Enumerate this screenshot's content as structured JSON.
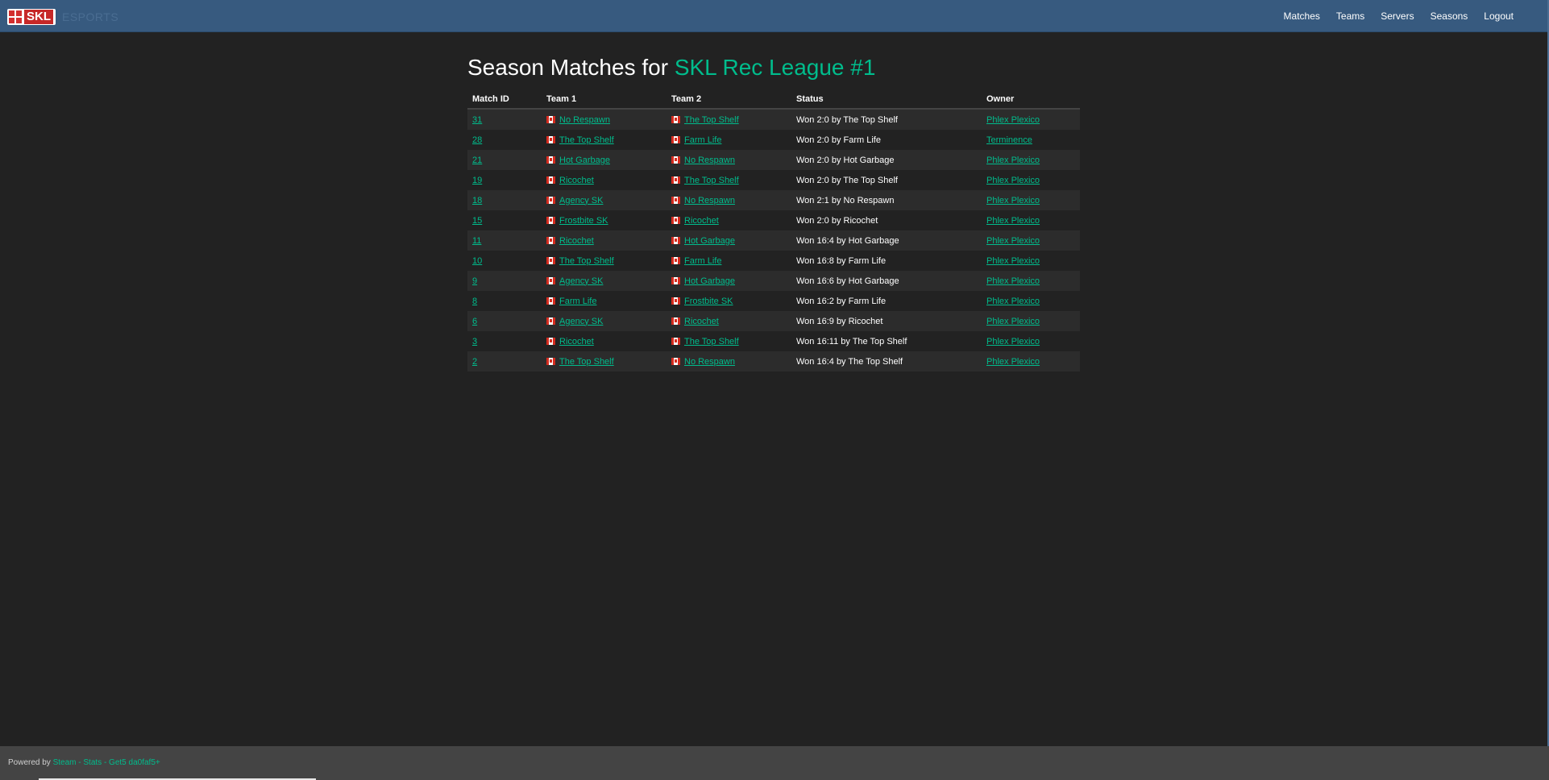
{
  "navbar": {
    "brand_text": "SKL",
    "brand_sub": "ESPORTS",
    "links": [
      "Matches",
      "Teams",
      "Servers",
      "Seasons",
      "Logout"
    ]
  },
  "page": {
    "title_prefix": "Season Matches for",
    "title_season": "SKL Rec League #1"
  },
  "table": {
    "headers": [
      "Match ID",
      "Team 1",
      "Team 2",
      "Status",
      "Owner"
    ],
    "rows": [
      {
        "id": "31",
        "team1": "No Respawn",
        "team2": "The Top Shelf",
        "status": "Won 2:0 by The Top Shelf",
        "owner": "Phlex Plexico"
      },
      {
        "id": "28",
        "team1": "The Top Shelf",
        "team2": "Farm Life",
        "status": "Won 2:0 by Farm Life",
        "owner": "Terminence"
      },
      {
        "id": "21",
        "team1": "Hot Garbage",
        "team2": "No Respawn",
        "status": "Won 2:0 by Hot Garbage",
        "owner": "Phlex Plexico"
      },
      {
        "id": "19",
        "team1": "Ricochet",
        "team2": "The Top Shelf",
        "status": "Won 2:0 by The Top Shelf",
        "owner": "Phlex Plexico"
      },
      {
        "id": "18",
        "team1": "Agency SK",
        "team2": "No Respawn",
        "status": "Won 2:1 by No Respawn",
        "owner": "Phlex Plexico"
      },
      {
        "id": "15",
        "team1": "Frostbite SK",
        "team2": "Ricochet",
        "status": "Won 2:0 by Ricochet",
        "owner": "Phlex Plexico"
      },
      {
        "id": "11",
        "team1": "Ricochet",
        "team2": "Hot Garbage",
        "status": "Won 16:4 by Hot Garbage",
        "owner": "Phlex Plexico"
      },
      {
        "id": "10",
        "team1": "The Top Shelf",
        "team2": "Farm Life",
        "status": "Won 16:8 by Farm Life",
        "owner": "Phlex Plexico"
      },
      {
        "id": "9",
        "team1": "Agency SK",
        "team2": "Hot Garbage",
        "status": "Won 16:6 by Hot Garbage",
        "owner": "Phlex Plexico"
      },
      {
        "id": "8",
        "team1": "Farm Life",
        "team2": "Frostbite SK",
        "status": "Won 16:2 by Farm Life",
        "owner": "Phlex Plexico"
      },
      {
        "id": "6",
        "team1": "Agency SK",
        "team2": "Ricochet",
        "status": "Won 16:9 by Ricochet",
        "owner": "Phlex Plexico"
      },
      {
        "id": "3",
        "team1": "Ricochet",
        "team2": "The Top Shelf",
        "status": "Won 16:11 by The Top Shelf",
        "owner": "Phlex Plexico"
      },
      {
        "id": "2",
        "team1": "The Top Shelf",
        "team2": "No Respawn",
        "status": "Won 16:4 by The Top Shelf",
        "owner": "Phlex Plexico"
      }
    ]
  },
  "footer": {
    "prefix": "Powered by",
    "link_text": "Steam - Stats - Get5 da0faf5+"
  },
  "colors": {
    "navbar": "#375a7f",
    "accent": "#00bc8c",
    "background": "#222222"
  }
}
